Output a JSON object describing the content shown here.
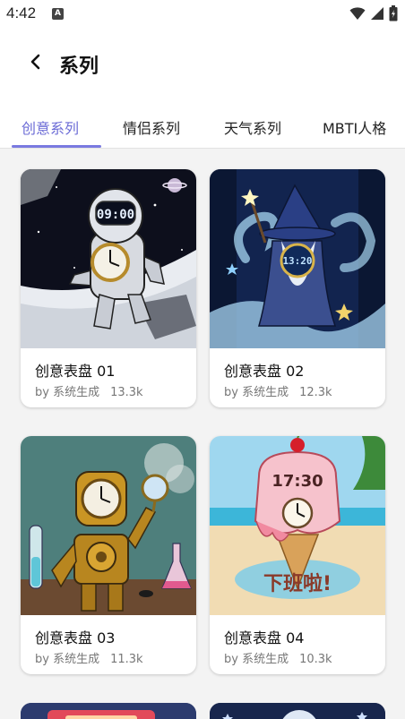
{
  "status_bar": {
    "time": "4:42",
    "a_icon": "A"
  },
  "header": {
    "title": "系列"
  },
  "tabs": [
    {
      "label": "创意系列",
      "active": true
    },
    {
      "label": "情侣系列",
      "active": false
    },
    {
      "label": "天气系列",
      "active": false
    },
    {
      "label": "MBTI人格",
      "active": false
    }
  ],
  "cards": [
    {
      "title": "创意表盘 01",
      "author": "by 系统生成",
      "count": "13.3k",
      "clock": "09:00",
      "theme": "astronaut"
    },
    {
      "title": "创意表盘 02",
      "author": "by 系统生成",
      "count": "12.3k",
      "clock": "13:20",
      "theme": "wizard"
    },
    {
      "title": "创意表盘 03",
      "author": "by 系统生成",
      "count": "11.3k",
      "theme": "steampunk-robot"
    },
    {
      "title": "创意表盘 04",
      "author": "by 系统生成",
      "count": "10.3k",
      "clock": "17:30",
      "sign": "下班啦!",
      "theme": "ice-cream"
    }
  ],
  "colors": {
    "accent": "#6b6bd6",
    "background": "#f3f3f3"
  }
}
